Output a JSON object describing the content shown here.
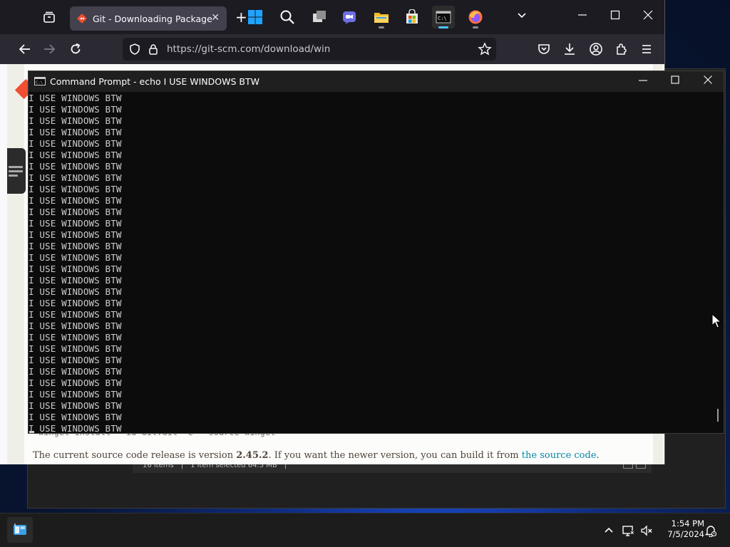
{
  "browser": {
    "tab_title": "Git - Downloading Package",
    "url": "https://git-scm.com/download/win",
    "page_code_snippet": "winget install --id Git.Git -e --source winget",
    "page_text_prefix": "The current source code release is version ",
    "page_text_version": "2.45.2",
    "page_text_middle": ". If you want the newer version, you can build it from ",
    "page_text_link": "the source code",
    "page_text_suffix": "."
  },
  "background_window": {
    "status_items": "16 items",
    "status_selected": "1 item selected  64.5 MB"
  },
  "cmd": {
    "title": "Command Prompt - echo  I USE WINDOWS BTW",
    "lines": [
      "I USE WINDOWS BTW",
      "I USE WINDOWS BTW",
      "I USE WINDOWS BTW",
      "I USE WINDOWS BTW",
      "I USE WINDOWS BTW",
      "I USE WINDOWS BTW",
      "I USE WINDOWS BTW",
      "I USE WINDOWS BTW",
      "I USE WINDOWS BTW",
      "I USE WINDOWS BTW",
      "I USE WINDOWS BTW",
      "I USE WINDOWS BTW",
      "I USE WINDOWS BTW",
      "I USE WINDOWS BTW",
      "I USE WINDOWS BTW",
      "I USE WINDOWS BTW",
      "I USE WINDOWS BTW",
      "I USE WINDOWS BTW",
      "I USE WINDOWS BTW",
      "I USE WINDOWS BTW",
      "I USE WINDOWS BTW",
      "I USE WINDOWS BTW",
      "I USE WINDOWS BTW",
      "I USE WINDOWS BTW",
      "I USE WINDOWS BTW",
      "I USE WINDOWS BTW",
      "I USE WINDOWS BTW",
      "I USE WINDOWS BTW",
      "I USE WINDOWS BTW",
      "I USE WINDOWS BTW"
    ]
  },
  "taskbar": {
    "apps": [
      "start-icon",
      "search-icon",
      "task-view-icon",
      "teams-chat-icon",
      "file-explorer-icon",
      "microsoft-store-icon",
      "terminal-icon",
      "firefox-icon"
    ],
    "time": "1:54 PM",
    "date": "7/5/2024"
  },
  "colors": {
    "git_orange": "#f14e32",
    "link_teal": "#0388a6",
    "terminal_bg": "#0c0c0c",
    "terminal_fg": "#cccccc",
    "taskbar_active": "#4cc2ff"
  }
}
